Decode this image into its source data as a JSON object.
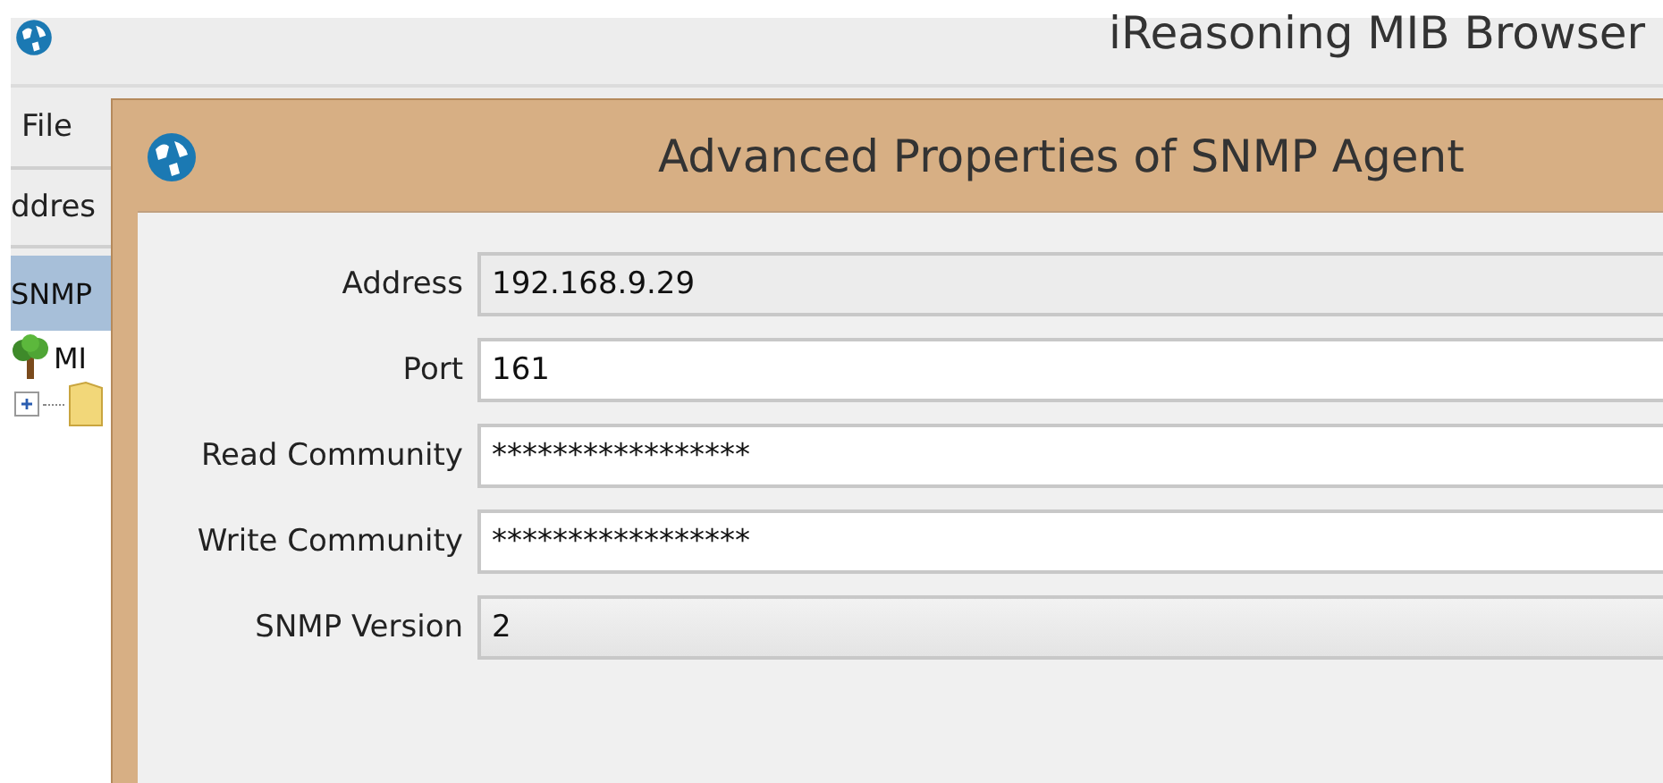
{
  "main_window": {
    "title": "iReasoning MIB Browser",
    "menu": [
      "File"
    ],
    "address_label": "ddres",
    "tab": "SNMP",
    "tree": [
      {
        "label": "MI",
        "kind": "tree",
        "children": [
          {
            "kind": "folder",
            "expanded": false
          }
        ]
      }
    ]
  },
  "dialog": {
    "title": "Advanced Properties of SNMP Agent",
    "fields": [
      {
        "label": "Address",
        "value": "192.168.9.29",
        "kind": "readonly"
      },
      {
        "label": "Port",
        "value": "161",
        "kind": "text"
      },
      {
        "label": "Read Community",
        "value": "*****************",
        "kind": "text"
      },
      {
        "label": "Write Community",
        "value": "*****************",
        "kind": "text"
      },
      {
        "label": "SNMP Version",
        "value": "2",
        "kind": "combo"
      }
    ]
  }
}
